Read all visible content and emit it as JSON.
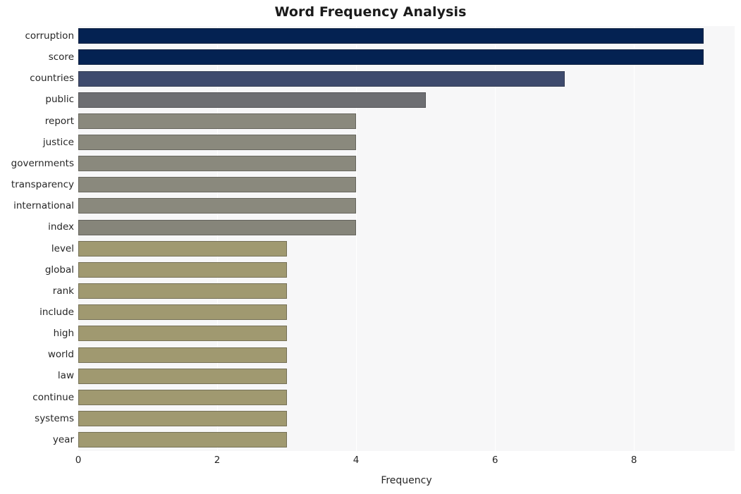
{
  "chart_data": {
    "type": "bar",
    "orientation": "horizontal",
    "title": "Word Frequency Analysis",
    "xlabel": "Frequency",
    "ylabel": "",
    "categories": [
      "corruption",
      "score",
      "countries",
      "public",
      "report",
      "justice",
      "governments",
      "transparency",
      "international",
      "index",
      "level",
      "global",
      "rank",
      "include",
      "high",
      "world",
      "law",
      "continue",
      "systems",
      "year"
    ],
    "values": [
      9,
      9,
      7,
      5,
      4,
      4,
      4,
      4,
      4,
      4,
      3,
      3,
      3,
      3,
      3,
      3,
      3,
      3,
      3,
      3
    ],
    "bar_colors": [
      "#042252",
      "#042252",
      "#3e4a6d",
      "#6d6e72",
      "#8a897d",
      "#8a897d",
      "#8a897d",
      "#8a897d",
      "#8a897d",
      "#86857a",
      "#a09970",
      "#a09970",
      "#a09970",
      "#a09970",
      "#a09970",
      "#a09970",
      "#a09970",
      "#a09970",
      "#a09970",
      "#a09970"
    ],
    "xlim": [
      0,
      9.45
    ],
    "x_ticks": [
      0,
      2,
      4,
      6,
      8
    ],
    "x_tick_labels": [
      "0",
      "2",
      "4",
      "6",
      "8"
    ],
    "grid": true,
    "grid_axis": "x",
    "legend": false,
    "plot_background": "#f7f7f8",
    "figure_background": "#ffffff"
  }
}
